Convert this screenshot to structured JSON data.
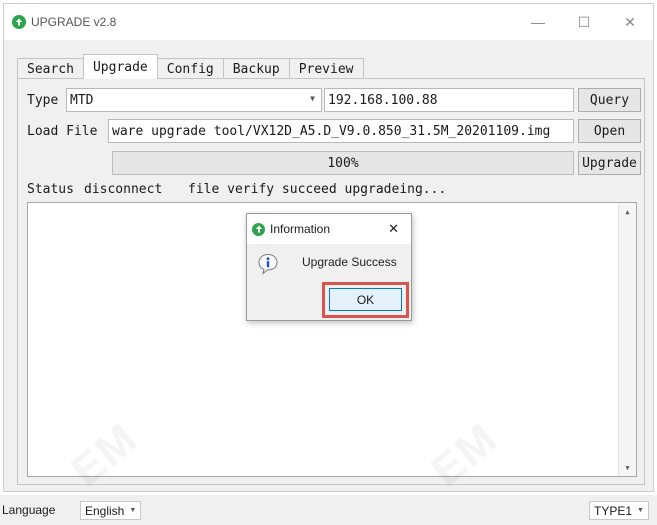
{
  "window": {
    "title": "UPGRADE v2.8",
    "minimize_glyph": "—",
    "maximize_glyph": "☐",
    "close_glyph": "✕"
  },
  "tabs": [
    {
      "label": "Search",
      "active": false
    },
    {
      "label": "Upgrade",
      "active": true
    },
    {
      "label": "Config",
      "active": false
    },
    {
      "label": "Backup",
      "active": false
    },
    {
      "label": "Preview",
      "active": false
    }
  ],
  "upgrade": {
    "type_label": "Type",
    "type_value": "MTD",
    "ip_address": "192.168.100.88",
    "query_button": "Query",
    "load_file_label": "Load File",
    "load_file_value": "ware upgrade tool/VX12D_A5.D_V9.0.850_31.5M_20201109.img",
    "open_button": "Open",
    "progress_text": "100%",
    "progress_value": 1.0,
    "upgrade_button": "Upgrade",
    "status_label": "Status",
    "status_connection": "disconnect",
    "status_message": "file verify succeed upgradeing..."
  },
  "dialog": {
    "title": "Information",
    "close_glyph": "✕",
    "message": "Upgrade Success",
    "ok_button": "OK",
    "icon": "info-icon",
    "highlight_color": "#d9534f"
  },
  "statusbar": {
    "language_label": "Language",
    "language_value": "English",
    "type_value": "TYPE1"
  },
  "colors": {
    "app_icon": "#2ea44f",
    "ok_border": "#0078d7"
  }
}
